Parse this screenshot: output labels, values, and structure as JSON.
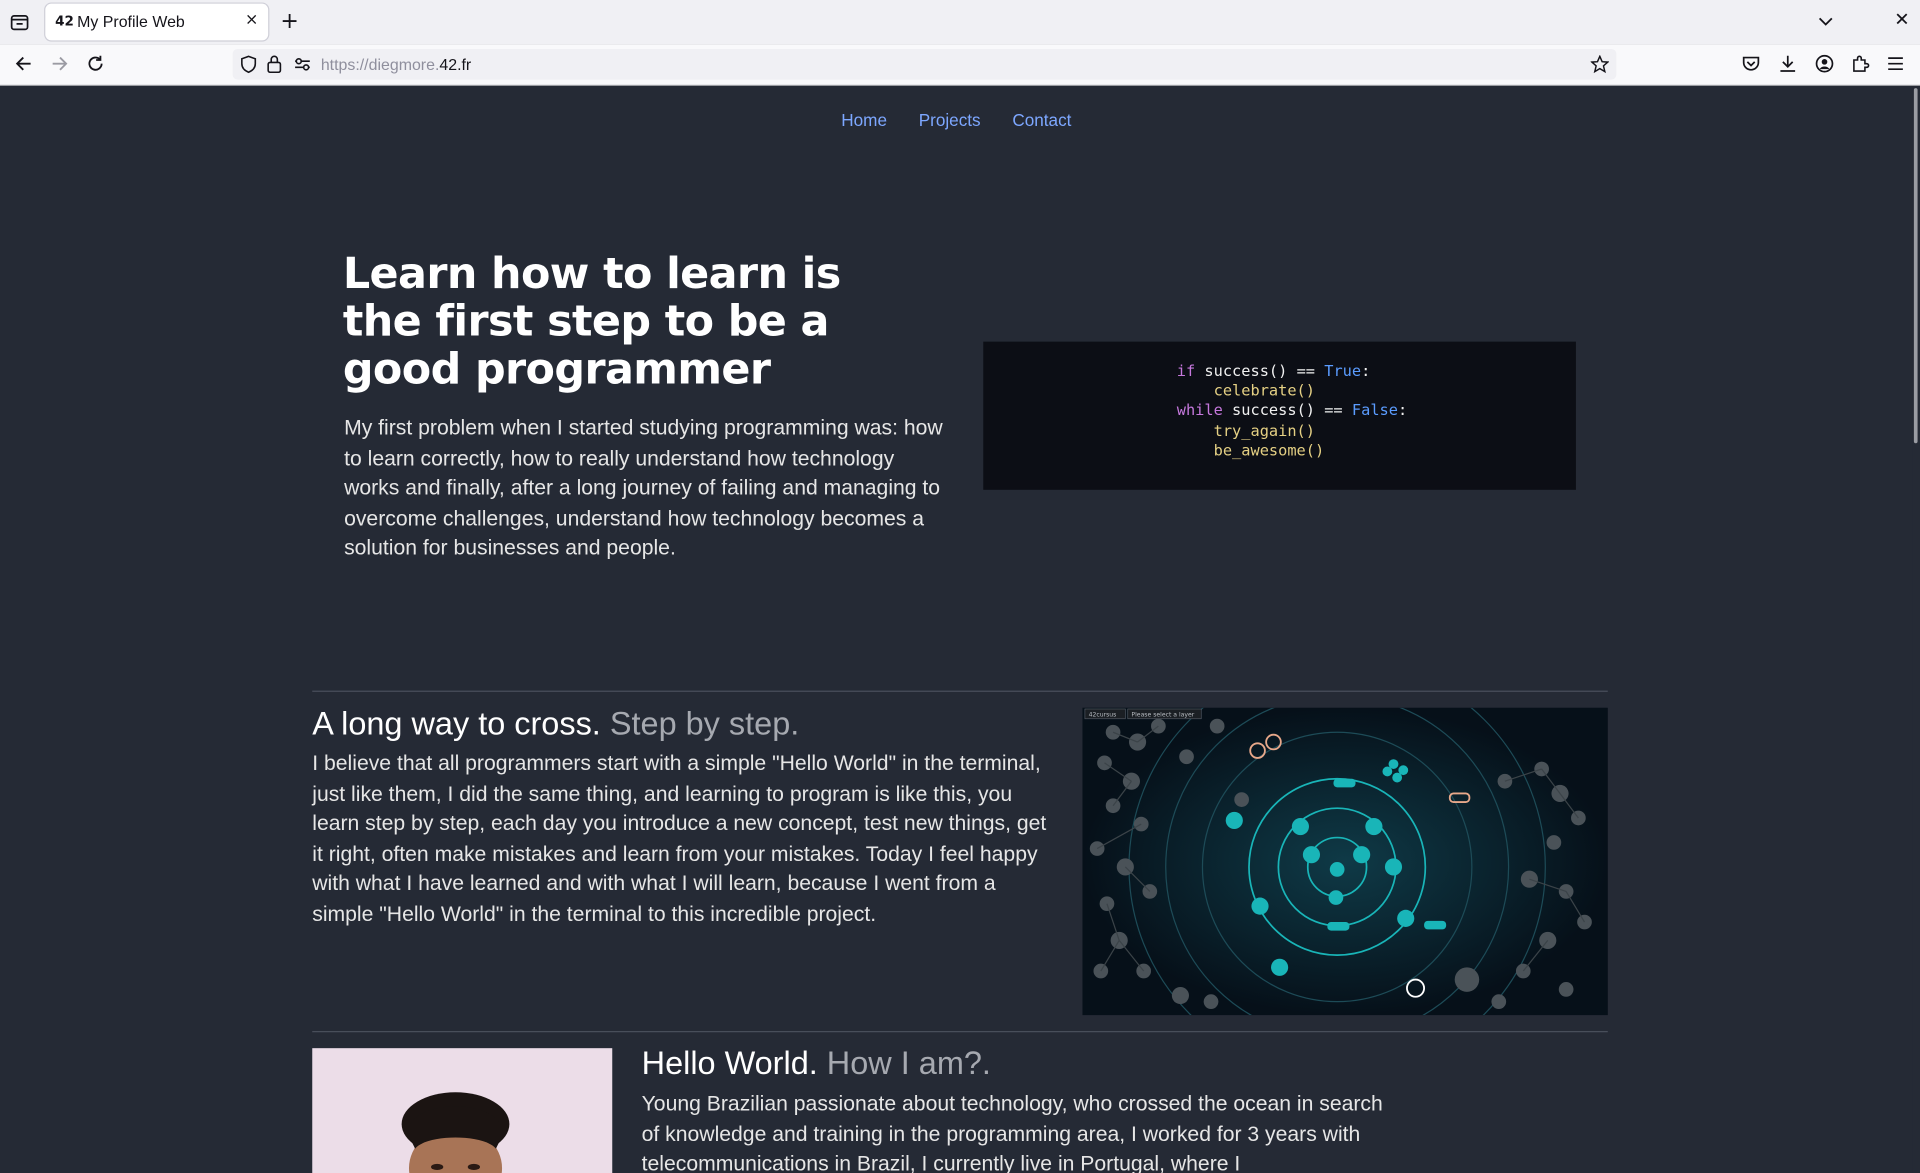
{
  "browser": {
    "tab_title": "My Profile Web",
    "tab_favicon": "42",
    "url_prefix": "https://diegmore.",
    "url_domain": "42.fr",
    "new_tab_label": "+",
    "close_tab_label": "×",
    "window_close_label": "✕"
  },
  "nav": {
    "home": "Home",
    "projects": "Projects",
    "contact": "Contact",
    "link_color": "#7da7ff"
  },
  "hero": {
    "title": "Learn how to learn is the first step to be a good programmer",
    "text": "My first problem when I started studying programming was: how to learn correctly, how to really understand how technology works and finally, after a long journey of failing and managing to overcome challenges, understand how technology becomes a solution for businesses and people."
  },
  "code": {
    "kw_if": "if",
    "call_success": "success()",
    "op_eq": "==",
    "val_true": "True",
    "colon": ":",
    "celebrate": "celebrate()",
    "kw_while": "while",
    "val_false": "False",
    "try_again": "try_again()",
    "be_awesome": "be_awesome()"
  },
  "section1": {
    "title_main": "A long way to cross.",
    "title_muted": "Step by step.",
    "text": "I believe that all programmers start with a simple \"Hello World\" in the terminal, just like them, I did the same thing, and learning to program is like this, you learn step by step, each day you introduce a new concept, test new things, get it right, often make mistakes and learn from your mistakes. Today I feel happy with what I have learned and with what I will learn, because I went from a simple \"Hello World\" in the terminal to this incredible project.",
    "graph_dropdown_1": "42cursus",
    "graph_dropdown_2": "Please select a layer"
  },
  "section2": {
    "title_main": "Hello World.",
    "title_muted": "How I am?.",
    "text": "Young Brazilian passionate about technology, who crossed the ocean in search of knowledge and training in the programming area, I worked for 3 years with telecommunications in Brazil, I currently live in Portugal, where I"
  },
  "colors": {
    "page_bg": "#252a35",
    "accent_teal": "#19b5b8",
    "code_bg": "#0c0e15"
  }
}
